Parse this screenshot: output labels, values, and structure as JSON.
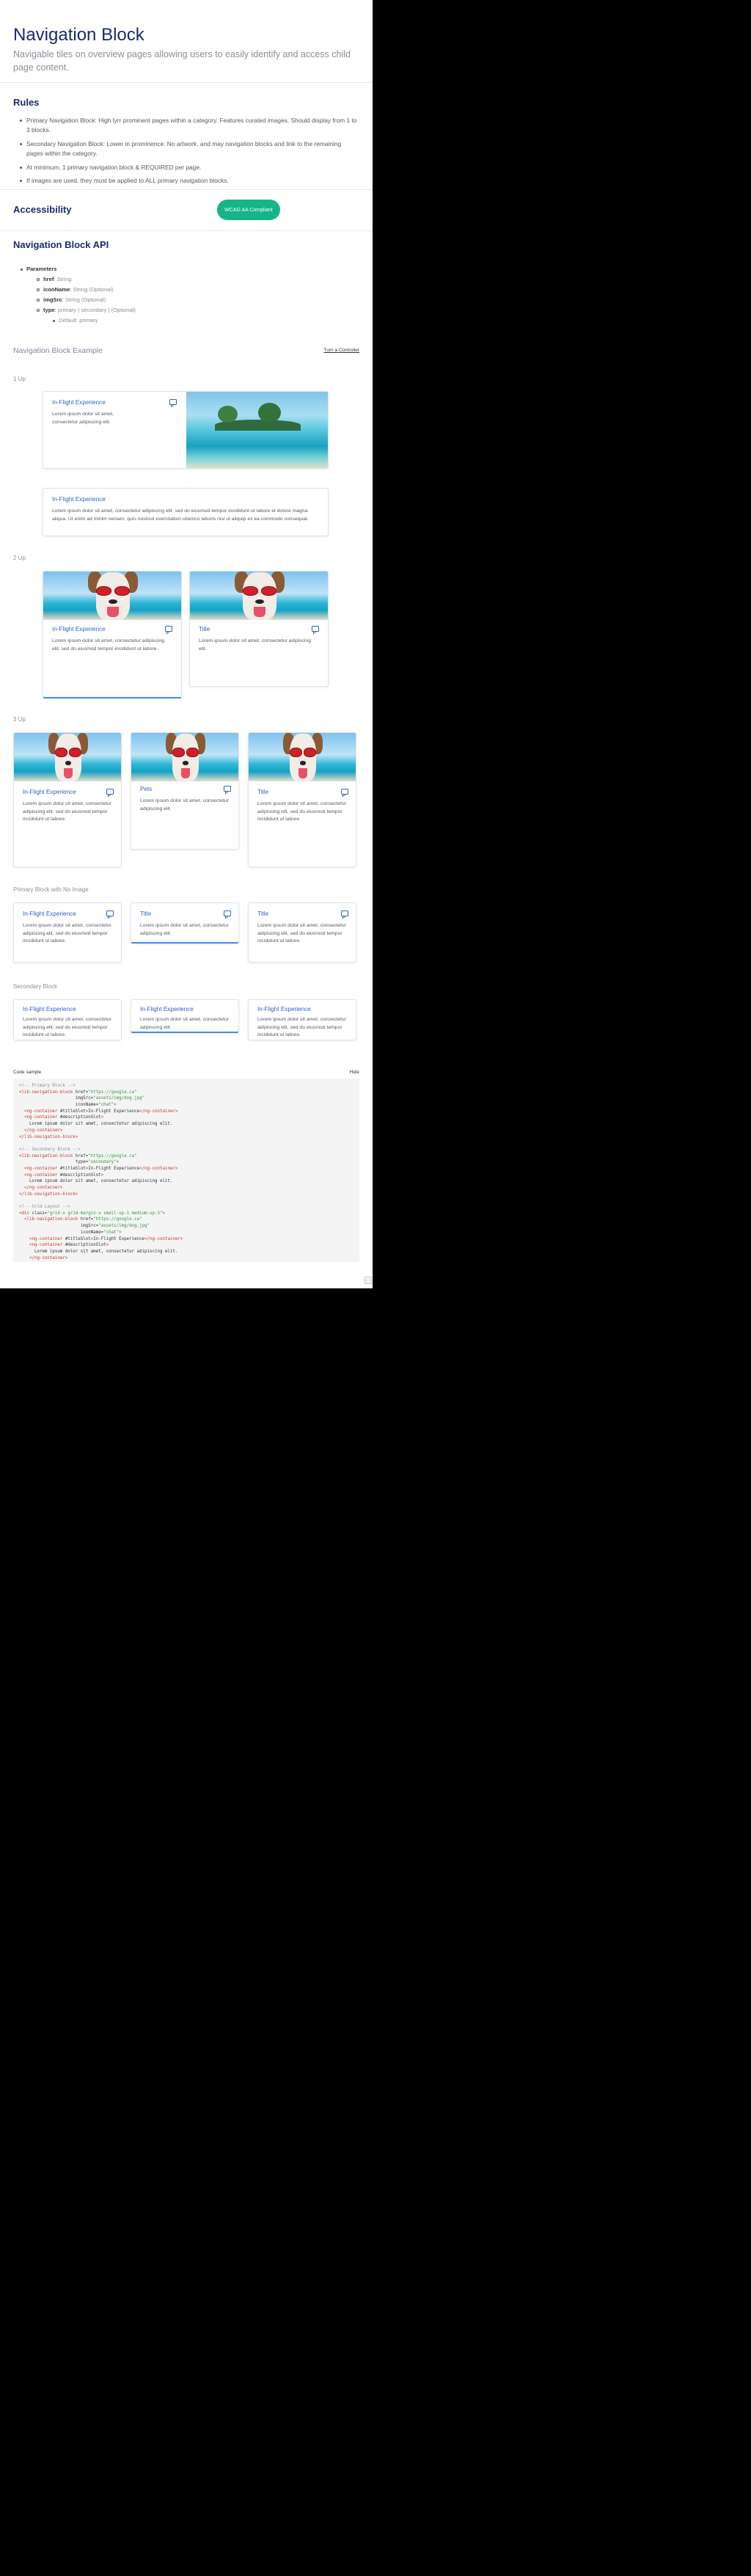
{
  "page": {
    "title": "Navigation Block",
    "subtitle": "Navigable tiles on overview pages allowing users to easily identify and access child page content."
  },
  "rules": {
    "heading": "Rules",
    "items": [
      "Primary Navigation Block: High lyrr prominent pages within a category. Features curated images. Should display from 1 to 3 blocks.",
      "Secondary Navigation Block: Lower in prominence. No artwork, and may navigation blocks and link to the remaining pages within the category.",
      "At minimum, 1 primary navigation block & REQUIRED per page.",
      "If images are used, they must be applied to ALL primary navigation blocks."
    ]
  },
  "accessibility": {
    "heading": "Accessibility",
    "badge": "WCAG AA Compliant"
  },
  "api": {
    "heading": "Navigation Block API",
    "params_label": "Parameters",
    "params": [
      {
        "name": "href",
        "type": "String"
      },
      {
        "name": "iconName",
        "type": "String (Optional)"
      },
      {
        "name": "imgSrc",
        "type": "String (Optional)"
      },
      {
        "name": "type",
        "type": "primary | secondary | (Optional)"
      }
    ],
    "default": "Default: primary"
  },
  "example": {
    "heading": "Navigation Block Example",
    "toggle": "Turn a Controller"
  },
  "sections": {
    "one_up": "1 Up",
    "two_up": "2 Up",
    "three_up": "3 Up",
    "primary_no_image": "Primary Block with No Image",
    "secondary": "Secondary Block"
  },
  "cards": {
    "one_a": {
      "title": "In-Flight Experience",
      "body": "Lorem ipsum dolor sit amet, consectetur adipiscing elit."
    },
    "one_b": {
      "title": "In-Flight Experience",
      "body": "Lorem ipsum dolor sit amet, consectetur adipiscing elit, sed do eiusmod tempor incididunt ut labore et dolore magna aliqua. Ut enim ad minim veniam, quis nostrud exercitation ullamco laboris nisi ut aliquip ex ea commodo consequat."
    },
    "two_a": {
      "title": "In-Flight Experience",
      "body": "Lorem ipsum dolor sit amet, consectetur adipiscing elit, sed do eiusmod tempor incididunt ut labore."
    },
    "two_b": {
      "title": "Title",
      "body": "Lorem ipsum dolor sit amet, consectetur adipiscing elit."
    },
    "three_a": {
      "title": "In-Flight Experience",
      "body": "Lorem ipsum dolor sit amet, consectetur adipiscing elit, sed do eiusmod tempor incididunt ut labore."
    },
    "three_b": {
      "title": "Pets",
      "body": "Lorem ipsum dolor sit amet, consectetur adipiscing elit."
    },
    "three_c": {
      "title": "Title",
      "body": "Lorem ipsum dolor sit amet, consectetur adipiscing elit, sed do eiusmod tempor incididunt ut labore."
    },
    "noimg_a": {
      "title": "In-Flight Experience",
      "body": "Lorem ipsum dolor sit amet, consectetur adipiscing elit, sed do eiusmod tempor incididunt ut labore."
    },
    "noimg_b": {
      "title": "Title",
      "body": "Lorem ipsum dolor sit amet, consectetur adipiscing elit."
    },
    "noimg_c": {
      "title": "Title",
      "body": "Lorem ipsum dolor sit amet, consectetur adipiscing elit, sed do eiusmod tempor incididunt ut labore."
    },
    "sec_a": {
      "title": "In-Flight Experience",
      "body": "Lorem ipsum dolor sit amet, consectetur adipiscing elit, sed do eiusmod tempor incididunt ut labore."
    },
    "sec_b": {
      "title": "In-Flight Experience",
      "body": "Lorem ipsum dolor sit amet, consectetur adipiscing elit."
    },
    "sec_c": {
      "title": "In-Flight Experience",
      "body": "Lorem ipsum dolor sit amet, consectetur adipiscing elit, sed do eiusmod tempor incididunt ut labore."
    }
  },
  "code": {
    "heading": "Code sample",
    "hide": "Hide"
  }
}
